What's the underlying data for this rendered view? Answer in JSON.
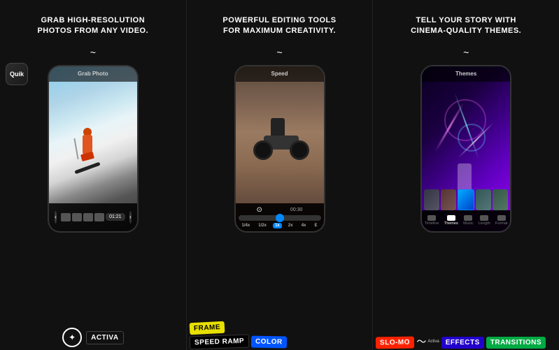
{
  "columns": [
    {
      "id": "col1",
      "heading": "GRAB HIGH-RESOLUTION\nPHOTOS FROM ANY VIDEO.",
      "phone_label": "Grab Photo",
      "nav_left": "‹",
      "nav_right": "›",
      "time": "01:21",
      "stickers": [
        {
          "text": "Activa",
          "style": "star",
          "color": "#ffffff"
        }
      ]
    },
    {
      "id": "col2",
      "heading": "POWERFUL EDITING TOOLS\nFOR MAXIMUM CREATIVITY.",
      "phone_label": "Speed",
      "speed_buttons": [
        "1/4x",
        "1/2x",
        "1x",
        "2x",
        "4x",
        "E"
      ],
      "active_speed": "1x",
      "time": "00:30",
      "stickers": [
        {
          "text": "FRAME",
          "style": "frame",
          "color": "#e8e000"
        },
        {
          "text": "SPEED RAMP",
          "style": "speed_ramp",
          "color": "#000000"
        },
        {
          "text": "COLOR",
          "style": "color",
          "color": "#0055ff"
        }
      ]
    },
    {
      "id": "col3",
      "heading": "TELL YOUR STORY WITH\nCINEMA-QUALITY THEMES.",
      "phone_label": "Themes",
      "tabs": [
        "Timeline",
        "Themes",
        "Music",
        "Length",
        "Format"
      ],
      "active_tab": "Themes",
      "stickers": [
        {
          "text": "SLO-MO",
          "style": "slo_mo",
          "color": "#ff2200"
        },
        {
          "text": "EFFECTS",
          "style": "effects",
          "color": "#2200cc"
        },
        {
          "text": "TRANSITIONS",
          "style": "transitions",
          "color": "#00aa44"
        }
      ]
    }
  ],
  "quik_badge": "Quik",
  "icons": {
    "star": "✦",
    "left_arrow": "❮",
    "right_arrow": "❯",
    "camera": "⊙",
    "play": "▶",
    "wave": "〜"
  },
  "colors": {
    "bg": "#111111",
    "accent_blue": "#0088ff",
    "accent_yellow": "#e8e000",
    "accent_red": "#ff2200",
    "phone_bg": "#1a1a1a",
    "phone_border": "#333333"
  }
}
